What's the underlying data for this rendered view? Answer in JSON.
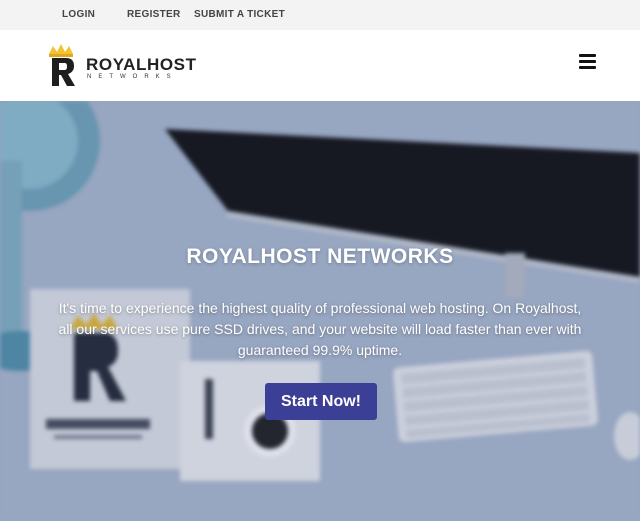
{
  "topbar": {
    "links": [
      {
        "label": "LOGIN"
      },
      {
        "label": "REGISTER"
      },
      {
        "label": "SUBMIT A TICKET"
      }
    ]
  },
  "header": {
    "logo_title": "ROYALHOST",
    "logo_subtitle": "NETWORKS",
    "menu_icon": "hamburger-icon"
  },
  "hero": {
    "title": "ROYALHOST NETWORKS",
    "text": "It's time to experience the highest quality of professional web hosting. On Royalhost, all our services use pure SSD drives, and your website will load faster than ever with guaranteed 99.9% uptime.",
    "cta_label": "Start Now!"
  },
  "colors": {
    "cta": "#3b3f95",
    "topbar": "#f3f3f3",
    "crown": "#f2c230"
  }
}
